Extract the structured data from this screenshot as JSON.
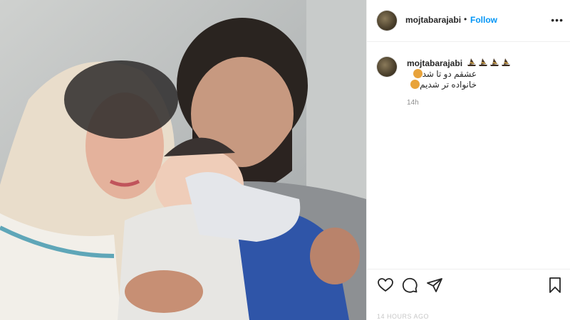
{
  "post": {
    "username": "mojtabarajabi",
    "follow_label": "Follow",
    "separator": "•",
    "more_label": "•••"
  },
  "caption": {
    "username": "mojtabarajabi",
    "line1": "عشقم دو تا شد",
    "line2": "خانواده تر شدیم",
    "time": "14h"
  },
  "footer": {
    "posted_label": "14 HOURS AGO"
  },
  "icons": [
    "heart-icon",
    "comment-icon",
    "share-icon",
    "bookmark-icon",
    "more-icon",
    "hat-emoji-icon",
    "heart-eyes-emoji-icon"
  ],
  "colors": {
    "follow": "#0095f6",
    "text": "#262626",
    "muted": "#8e8e8e",
    "divider": "#efefef"
  }
}
